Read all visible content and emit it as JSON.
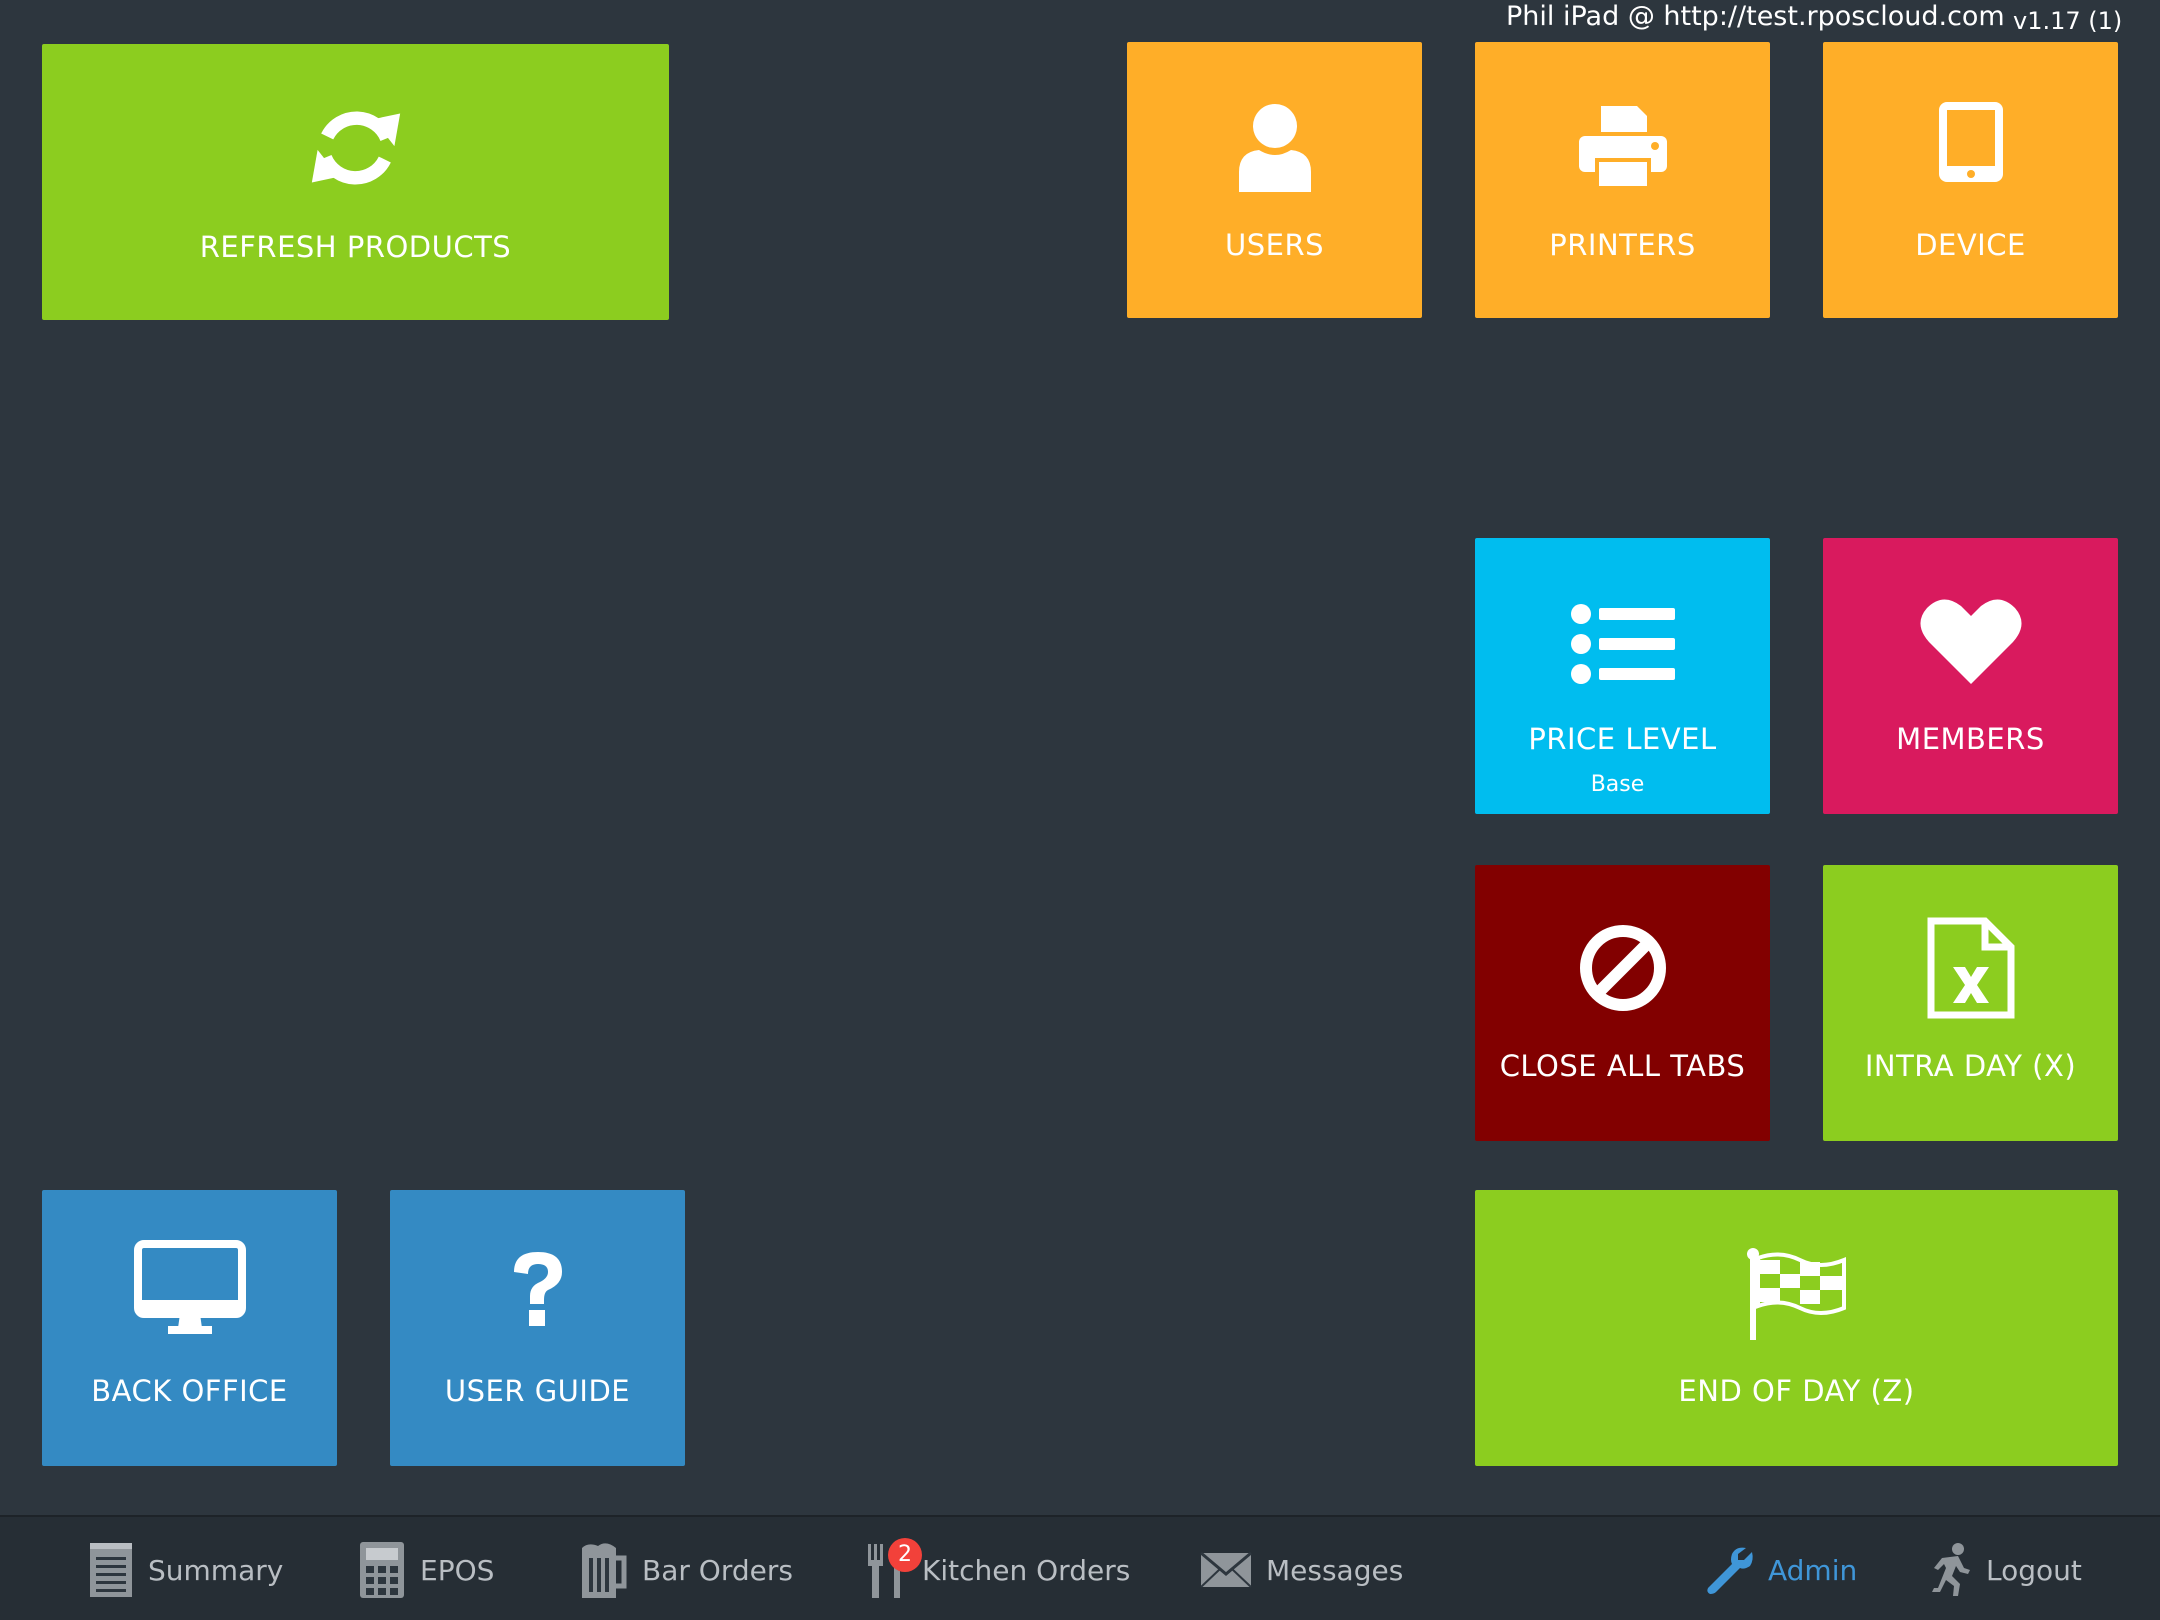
{
  "header": {
    "device_info": "Phil iPad @ http://test.rposcloud.com",
    "version": "v1.17 (1)"
  },
  "colors": {
    "background": "#2d363e",
    "green": "#8ccd1f",
    "orange": "#ffae28",
    "cyan": "#00bdef",
    "pink": "#d91a5e",
    "dark_red": "#820000",
    "blue": "#348ac3",
    "nav_active": "#3f96d8"
  },
  "tiles": {
    "refresh_products": {
      "label": "REFRESH PRODUCTS",
      "icon": "refresh-icon"
    },
    "users": {
      "label": "USERS",
      "icon": "user-icon"
    },
    "printers": {
      "label": "PRINTERS",
      "icon": "printer-icon"
    },
    "device": {
      "label": "DEVICE",
      "icon": "tablet-icon"
    },
    "price_level": {
      "label": "PRICE LEVEL",
      "sub": "Base",
      "icon": "list-icon"
    },
    "members": {
      "label": "MEMBERS",
      "icon": "heart-icon"
    },
    "close_all_tabs": {
      "label": "CLOSE ALL TABS",
      "icon": "ban-icon"
    },
    "intra_day": {
      "label": "INTRA DAY (X)",
      "icon": "excel-file-icon"
    },
    "back_office": {
      "label": "BACK OFFICE",
      "icon": "monitor-icon"
    },
    "user_guide": {
      "label": "USER GUIDE",
      "icon": "question-icon"
    },
    "end_of_day": {
      "label": "END OF DAY (Z)",
      "icon": "checkered-flag-icon"
    }
  },
  "nav": {
    "summary": {
      "label": "Summary",
      "icon": "notepad-icon"
    },
    "epos": {
      "label": "EPOS",
      "icon": "calculator-icon"
    },
    "bar_orders": {
      "label": "Bar Orders",
      "icon": "beer-mug-icon"
    },
    "kitchen_orders": {
      "label": "Kitchen Orders",
      "icon": "fork-knife-icon",
      "badge": "2"
    },
    "messages": {
      "label": "Messages",
      "icon": "envelope-icon"
    },
    "admin": {
      "label": "Admin",
      "icon": "wrench-icon",
      "active": true
    },
    "logout": {
      "label": "Logout",
      "icon": "running-man-icon"
    }
  }
}
